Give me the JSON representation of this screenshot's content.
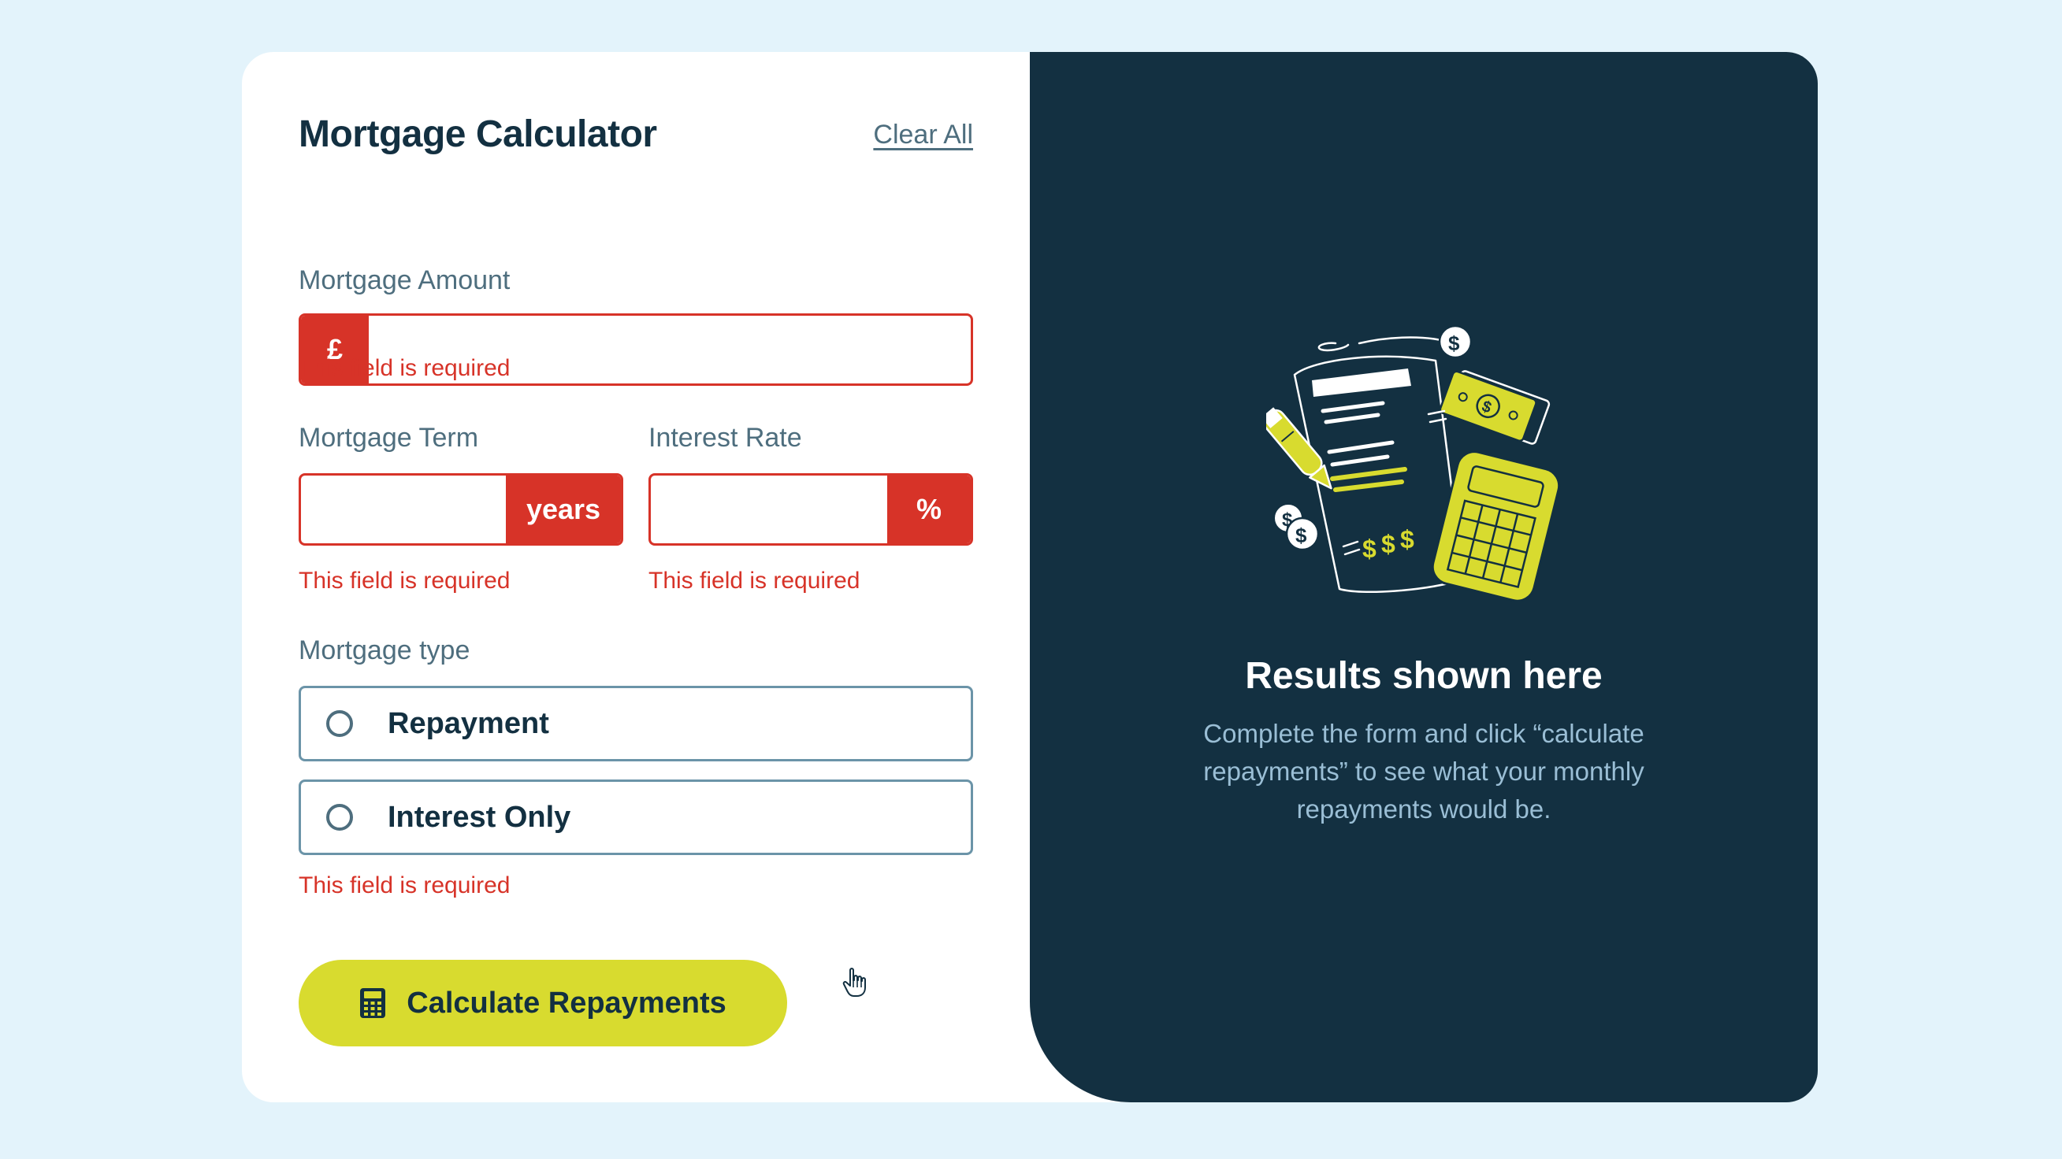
{
  "form": {
    "title": "Mortgage Calculator",
    "clear_all": "Clear All",
    "amount": {
      "label": "Mortgage Amount",
      "prefix": "£",
      "value": "",
      "error": "This field is required"
    },
    "term": {
      "label": "Mortgage Term",
      "suffix": "years",
      "value": "",
      "error": "This field is required"
    },
    "rate": {
      "label": "Interest Rate",
      "suffix": "%",
      "value": "",
      "error": "This field is required"
    },
    "type": {
      "label": "Mortgage type",
      "options": [
        {
          "label": "Repayment",
          "selected": false
        },
        {
          "label": "Interest Only",
          "selected": false
        }
      ],
      "error": "This field is required"
    },
    "submit_label": "Calculate Repayments"
  },
  "results": {
    "title": "Results shown here",
    "description": "Complete the form and click “calculate repayments” to see what your monthly repayments would be."
  },
  "colors": {
    "dark_navy": "#133041",
    "slate": "#4e6e7e",
    "lime": "#d8db2f",
    "error_red": "#d73328",
    "page_background": "#e3f3fb"
  },
  "icons": {
    "button_icon": "calculator-icon",
    "illustration": "empty-results-illustration",
    "cursor": "hand-pointer-cursor-icon"
  }
}
